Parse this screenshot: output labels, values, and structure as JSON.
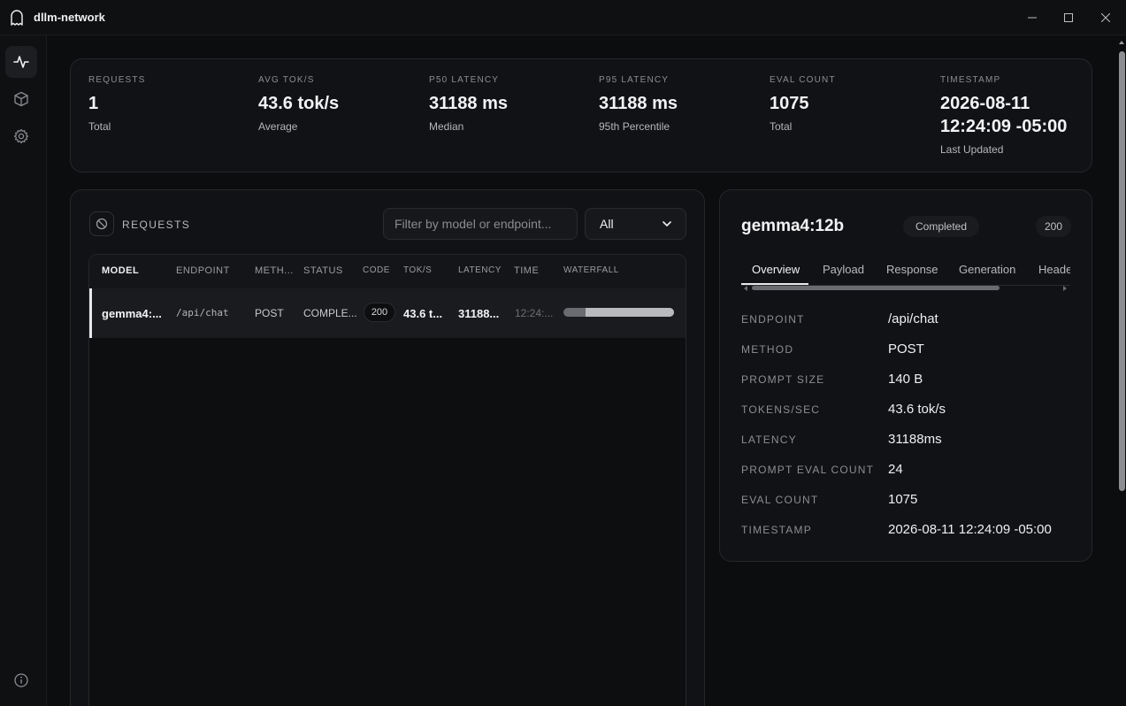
{
  "app": {
    "title": "dllm-network"
  },
  "stats": [
    {
      "label": "REQUESTS",
      "value": "1",
      "sub": "Total"
    },
    {
      "label": "AVG TOK/S",
      "value": "43.6 tok/s",
      "sub": "Average"
    },
    {
      "label": "P50 LATENCY",
      "value": "31188 ms",
      "sub": "Median"
    },
    {
      "label": "P95 LATENCY",
      "value": "31188 ms",
      "sub": "95th Percentile"
    },
    {
      "label": "EVAL COUNT",
      "value": "1075",
      "sub": "Total"
    },
    {
      "label": "TIMESTAMP",
      "value": "2026-08-11 12:24:09 -05:00",
      "sub": "Last Updated"
    }
  ],
  "requests": {
    "title": "REQUESTS",
    "filter_placeholder": "Filter by model or endpoint...",
    "filter_value": "",
    "select_value": "All",
    "columns": [
      "MODEL",
      "ENDPOINT",
      "METH...",
      "STATUS",
      "CODE",
      "TOK/S",
      "LATENCY",
      "TIME",
      "WATERFALL"
    ],
    "rows": [
      {
        "model": "gemma4:...",
        "endpoint": "/api/chat",
        "method": "POST",
        "status": "COMPLE...",
        "code": "200",
        "toks": "43.6 t...",
        "latency": "31188...",
        "time": "12:24:...",
        "waterfall_start": 0.2,
        "waterfall_fraction": 0.8
      }
    ]
  },
  "detail": {
    "title": "gemma4:12b",
    "status": "Completed",
    "code": "200",
    "tabs": [
      "Overview",
      "Payload",
      "Response",
      "Generation",
      "Heade"
    ],
    "fields": [
      {
        "key": "ENDPOINT",
        "value": "/api/chat"
      },
      {
        "key": "METHOD",
        "value": "POST"
      },
      {
        "key": "PROMPT SIZE",
        "value": "140 B"
      },
      {
        "key": "TOKENS/SEC",
        "value": "43.6 tok/s"
      },
      {
        "key": "LATENCY",
        "value": "31188ms"
      },
      {
        "key": "PROMPT EVAL COUNT",
        "value": "24"
      },
      {
        "key": "EVAL COUNT",
        "value": "1075"
      },
      {
        "key": "TIMESTAMP",
        "value": "2026-08-11 12:24:09 -05:00"
      }
    ]
  },
  "icons": {
    "app": "ghost-icon",
    "sidebar": [
      "activity-icon",
      "cube-icon",
      "gear-icon",
      "info-icon"
    ],
    "requests": "clear-icon"
  },
  "colors": {
    "background": "#0c0d0f",
    "card": "#111215",
    "accent": "#e8e8ea"
  }
}
